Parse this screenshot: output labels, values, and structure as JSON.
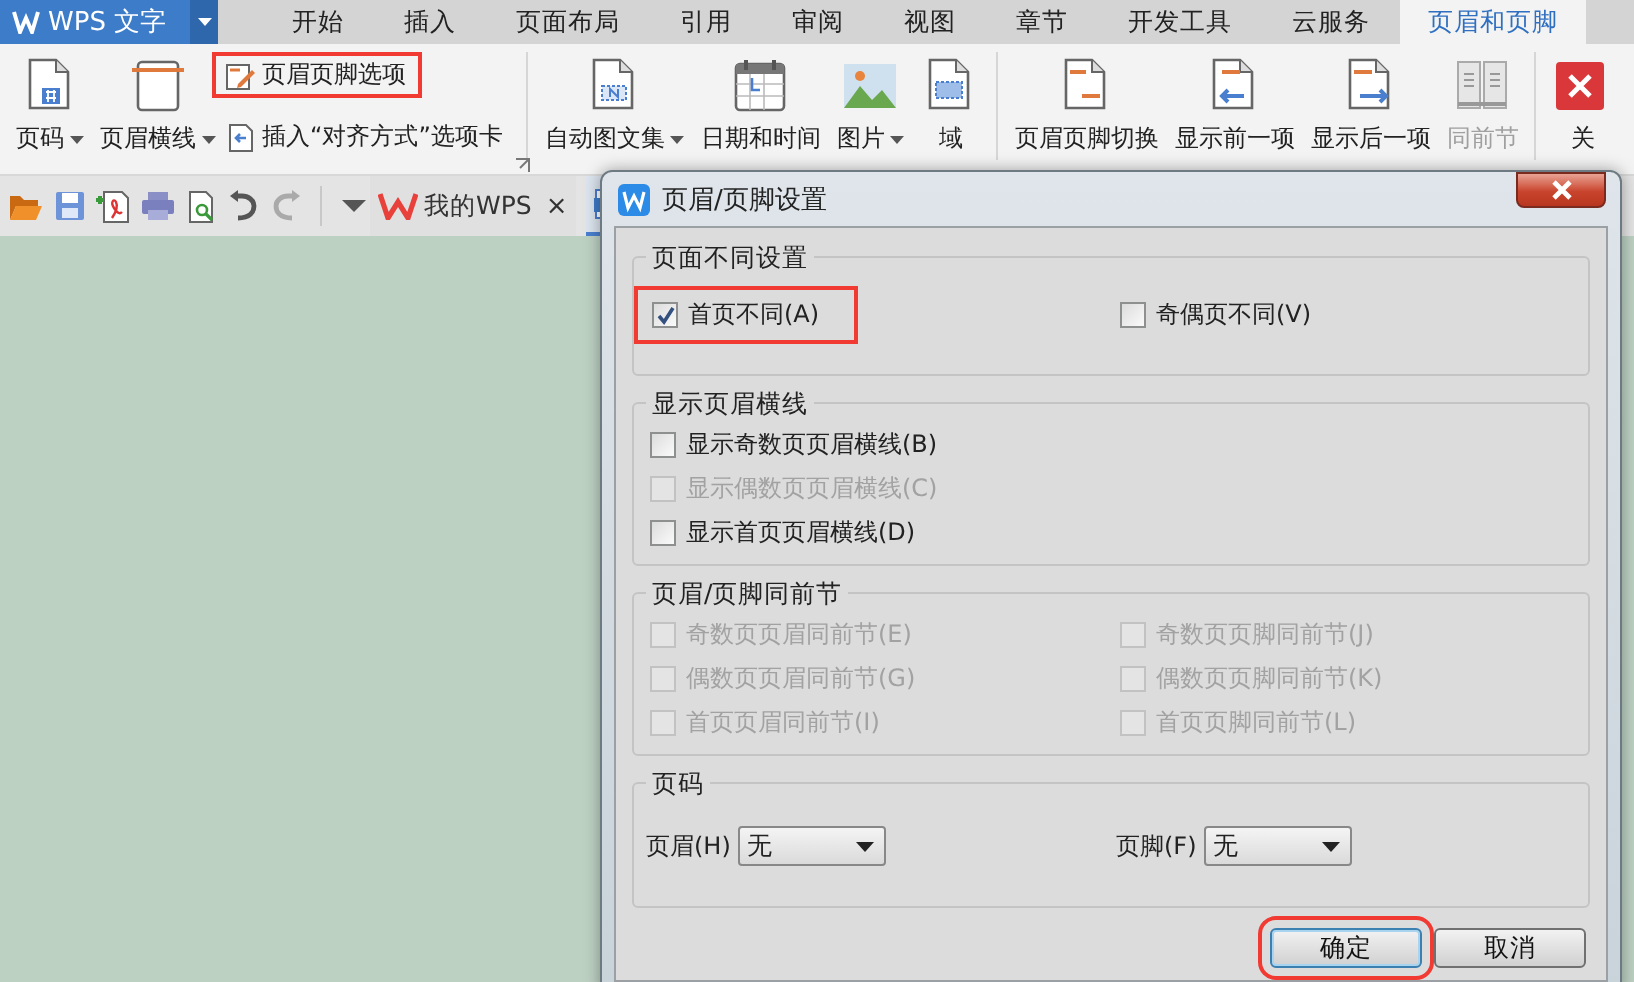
{
  "app_menu": {
    "label": "WPS 文字"
  },
  "menu_tabs": [
    {
      "label": "开始",
      "selected": false
    },
    {
      "label": "插入",
      "selected": false
    },
    {
      "label": "页面布局",
      "selected": false
    },
    {
      "label": "引用",
      "selected": false
    },
    {
      "label": "审阅",
      "selected": false
    },
    {
      "label": "视图",
      "selected": false
    },
    {
      "label": "章节",
      "selected": false
    },
    {
      "label": "开发工具",
      "selected": false
    },
    {
      "label": "云服务",
      "selected": false
    },
    {
      "label": "页眉和页脚",
      "selected": true
    }
  ],
  "ribbon": {
    "groups": [
      {
        "items": [
          {
            "kind": "large",
            "label": "页码",
            "dropdown": true,
            "disabled": false,
            "highlighted": false
          },
          {
            "kind": "large",
            "label": "页眉横线",
            "dropdown": true,
            "disabled": false,
            "highlighted": false
          },
          {
            "kind": "small",
            "label": "页眉页脚选项",
            "dropdown": false,
            "disabled": false,
            "highlighted": true
          },
          {
            "kind": "small",
            "label": "插入“对齐方式”选项卡",
            "dropdown": false,
            "disabled": false,
            "highlighted": false
          }
        ]
      },
      {
        "items": [
          {
            "kind": "large",
            "label": "自动图文集",
            "dropdown": true,
            "disabled": false,
            "highlighted": false
          },
          {
            "kind": "large",
            "label": "日期和时间",
            "dropdown": false,
            "disabled": false,
            "highlighted": false
          },
          {
            "kind": "large",
            "label": "图片",
            "dropdown": true,
            "disabled": false,
            "highlighted": false
          },
          {
            "kind": "large",
            "label": "域",
            "dropdown": false,
            "disabled": false,
            "highlighted": false
          }
        ]
      },
      {
        "items": [
          {
            "kind": "large",
            "label": "页眉页脚切换",
            "dropdown": false,
            "disabled": false,
            "highlighted": false
          },
          {
            "kind": "large",
            "label": "显示前一项",
            "dropdown": false,
            "disabled": false,
            "highlighted": false
          },
          {
            "kind": "large",
            "label": "显示后一项",
            "dropdown": false,
            "disabled": false,
            "highlighted": false
          },
          {
            "kind": "large",
            "label": "同前节",
            "dropdown": false,
            "disabled": true,
            "highlighted": false
          }
        ]
      },
      {
        "items": [
          {
            "kind": "large",
            "label": "关",
            "dropdown": false,
            "disabled": false,
            "highlighted": false
          }
        ]
      }
    ]
  },
  "doc_tabs": [
    {
      "label": "我的WPS",
      "close": "×"
    }
  ],
  "dialog": {
    "title": "页眉/页脚设置",
    "groups": [
      {
        "kind": "checkbox-grid",
        "title": "页面不同设置",
        "checkboxes": [
          {
            "label": "首页不同(A)",
            "checked": true,
            "disabled": false,
            "highlighted": true
          },
          {
            "label": "奇偶页不同(V)",
            "checked": false,
            "disabled": false,
            "highlighted": false
          }
        ]
      },
      {
        "kind": "checkbox-list",
        "title": "显示页眉横线",
        "checkboxes": [
          {
            "label": "显示奇数页页眉横线(B)",
            "checked": false,
            "disabled": false,
            "highlighted": false
          },
          {
            "label": "显示偶数页页眉横线(C)",
            "checked": false,
            "disabled": true,
            "highlighted": false
          },
          {
            "label": "显示首页页眉横线(D)",
            "checked": false,
            "disabled": false,
            "highlighted": false
          }
        ]
      },
      {
        "kind": "checkbox-grid",
        "title": "页眉/页脚同前节",
        "checkboxes": [
          {
            "label": "奇数页页眉同前节(E)",
            "checked": false,
            "disabled": true,
            "highlighted": false
          },
          {
            "label": "奇数页页脚同前节(J)",
            "checked": false,
            "disabled": true,
            "highlighted": false
          },
          {
            "label": "偶数页页眉同前节(G)",
            "checked": false,
            "disabled": true,
            "highlighted": false
          },
          {
            "label": "偶数页页脚同前节(K)",
            "checked": false,
            "disabled": true,
            "highlighted": false
          },
          {
            "label": "首页页眉同前节(I)",
            "checked": false,
            "disabled": true,
            "highlighted": false
          },
          {
            "label": "首页页脚同前节(L)",
            "checked": false,
            "disabled": true,
            "highlighted": false
          }
        ]
      },
      {
        "kind": "select-row",
        "title": "页码",
        "selects": [
          {
            "label": "页眉(H)",
            "value": "无"
          },
          {
            "label": "页脚(F)",
            "value": "无"
          }
        ]
      }
    ],
    "buttons": [
      {
        "label": "确定",
        "focused": true,
        "highlighted": true
      },
      {
        "label": "取消",
        "focused": false,
        "highlighted": false
      }
    ]
  }
}
